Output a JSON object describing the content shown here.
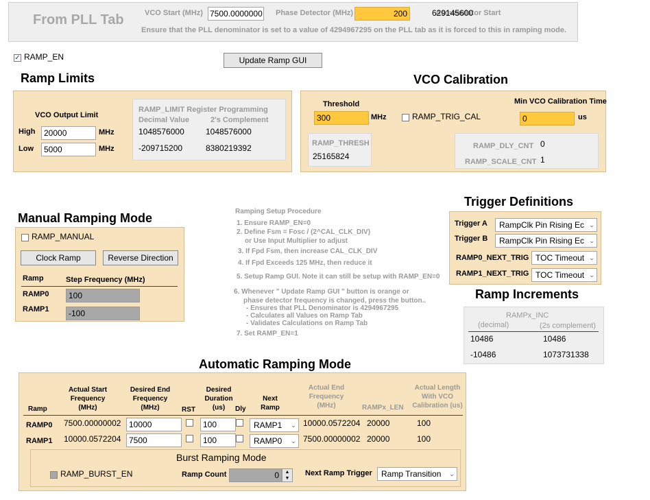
{
  "pll": {
    "title": "From PLL Tab",
    "vco_start_label": "VCO Start (MHz)",
    "vco_start_value": "7500.0000000",
    "phase_detector_label": "Phase Detector (MHz)",
    "phase_detector_value": "200",
    "accumulator_start_label": "Accumulator Start",
    "accumulator_start_value": "629145600",
    "note": "Ensure that the PLL denominator is set to a value of 4294967295 on the PLL tab as it is forced to this in ramping mode."
  },
  "ramp_en": {
    "label": "RAMP_EN",
    "checked_glyph": "✓"
  },
  "update_button": "Update Ramp GUI",
  "ramp_limits": {
    "title": "Ramp Limits",
    "vco_output_limit": "VCO Output Limit",
    "high_label": "High",
    "high_value": "20000",
    "low_label": "Low",
    "low_value": "5000",
    "unit": "MHz",
    "register_title": "RAMP_LIMIT Register Programming",
    "decimal_header": "Decimal Value",
    "complement_header": "2's Complement",
    "high_decimal": "1048576000",
    "high_complement": "1048576000",
    "low_decimal": "-209715200",
    "low_complement": "8380219392"
  },
  "vco_cal": {
    "title": "VCO Calibration",
    "threshold_label": "Threshold",
    "threshold_value": "300",
    "threshold_unit": "MHz",
    "trig_cal_label": "RAMP_TRIG_CAL",
    "min_time_label": "Min VCO Calibration Time",
    "min_time_value": "0",
    "min_time_unit": "us",
    "ramp_thresh_label": "RAMP_THRESH",
    "ramp_thresh_value": "25165824",
    "dly_cnt_label": "RAMP_DLY_CNT",
    "dly_cnt_value": "0",
    "scale_cnt_label": "RAMP_SCALE_CNT",
    "scale_cnt_value": "1"
  },
  "manual": {
    "title": "Manual Ramping Mode",
    "ramp_manual_label": "RAMP_MANUAL",
    "clock_ramp_button": "Clock Ramp",
    "reverse_button": "Reverse Direction",
    "ramp_header": "Ramp",
    "step_header": "Step Frequency (MHz)",
    "rows": [
      {
        "name": "RAMP0",
        "step": "100"
      },
      {
        "name": "RAMP1",
        "step": "-100"
      }
    ]
  },
  "procedure": {
    "title": "Ramping Setup Procedure",
    "lines": [
      "1.  Ensure RAMP_EN=0",
      "2.  Define  Fsm = Fosc / (2^CAL_CLK_DIV)",
      "or Use Input Multiplier to adjust",
      "3.  If Fpd   Fsm, then increase CAL_CLK_DIV",
      "4.  If Fpd Exceeds 125 MHz, then reduce it",
      "5.   Setup Ramp GUI.  Note it can still be setup with RAMP_EN=0",
      "6.  Whenever  \" Update Ramp GUI \"  button is orange or",
      "phase detector frequency is changed, press the button..",
      "- Ensures that PLL Denominator is 4294967295",
      "- Calculates all Values on Ramp Tab",
      "- Validates Calculations on Ramp Tab",
      "7.  Set RAMP_EN=1"
    ]
  },
  "trigger": {
    "title": "Trigger Definitions",
    "trigger_a_label": "Trigger A",
    "trigger_a_value": "RampClk Pin Rising Ec",
    "trigger_b_label": "Trigger  B",
    "trigger_b_value": "RampClk Pin Rising Ec",
    "ramp0_next_label": "RAMP0_NEXT_TRIG",
    "ramp0_next_value": "TOC Timeout",
    "ramp1_next_label": "RAMP1_NEXT_TRIG",
    "ramp1_next_value": "TOC Timeout"
  },
  "increments": {
    "title": "Ramp Increments",
    "header": "RAMPx_INC",
    "decimal_header": "(decimal)",
    "complement_header": "(2s complement)",
    "rows": [
      {
        "decimal": "10486",
        "complement": "10486"
      },
      {
        "decimal": "-10486",
        "complement": "1073731338"
      }
    ]
  },
  "auto": {
    "title": "Automatic Ramping Mode",
    "headers": {
      "ramp": "Ramp",
      "actual_start": [
        "Actual Start",
        "Frequency",
        "(MHz)"
      ],
      "desired_end": [
        "Desired End",
        "Frequency",
        "(MHz)"
      ],
      "rst": "RST",
      "desired_duration": [
        "Desired",
        "Duration",
        "(us)"
      ],
      "dly": "Dly",
      "next_ramp": [
        "Next",
        "Ramp"
      ],
      "actual_end": [
        "Actual End",
        "Frequency",
        "(MHz)"
      ],
      "ramp_len": "RAMPx_LEN",
      "actual_length": [
        "Actual Length",
        "With VCO",
        "Calibration (us)"
      ]
    },
    "rows": [
      {
        "name": "RAMP0",
        "actual_start": "7500.00000002",
        "desired_end": "10000",
        "duration": "100",
        "next": "RAMP1",
        "actual_end": "10000.0572204",
        "len": "20000",
        "actual_length": "100"
      },
      {
        "name": "RAMP1",
        "actual_start": "10000.0572204",
        "desired_end": "7500",
        "duration": "100",
        "next": "RAMP0",
        "actual_end": "7500.00000002",
        "len": "20000",
        "actual_length": "100"
      }
    ],
    "burst": {
      "title": "Burst Ramping Mode",
      "burst_en_label": "RAMP_BURST_EN",
      "ramp_count_label": "Ramp Count",
      "ramp_count_value": "0",
      "next_trigger_label": "Next Ramp Trigger",
      "next_trigger_value": "Ramp Transition"
    }
  },
  "colors": {
    "tan": "#f7e3bd",
    "yellow": "#ffc83d",
    "gray": "#efefef"
  }
}
